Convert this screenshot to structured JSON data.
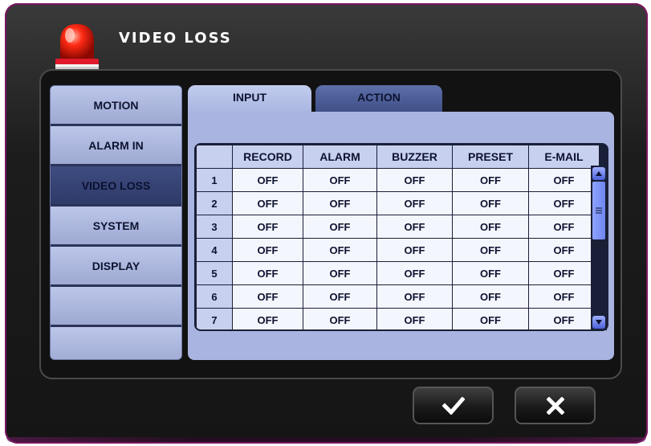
{
  "dialog": {
    "title": "VIDEO LOSS",
    "icon": "alarm-siren-icon"
  },
  "sidebar": {
    "items": [
      {
        "label": "MOTION",
        "active": false
      },
      {
        "label": "ALARM IN",
        "active": false
      },
      {
        "label": "VIDEO LOSS",
        "active": true
      },
      {
        "label": "SYSTEM",
        "active": false
      },
      {
        "label": "DISPLAY",
        "active": false
      },
      {
        "label": "",
        "active": false
      },
      {
        "label": "",
        "active": false
      }
    ]
  },
  "tabs": [
    {
      "label": "INPUT",
      "active": false
    },
    {
      "label": "ACTION",
      "active": true
    }
  ],
  "table": {
    "columns": [
      "",
      "RECORD",
      "ALARM",
      "BUZZER",
      "PRESET",
      "E-MAIL"
    ],
    "rows": [
      {
        "num": "1",
        "cells": [
          "OFF",
          "OFF",
          "OFF",
          "OFF",
          "OFF"
        ]
      },
      {
        "num": "2",
        "cells": [
          "OFF",
          "OFF",
          "OFF",
          "OFF",
          "OFF"
        ]
      },
      {
        "num": "3",
        "cells": [
          "OFF",
          "OFF",
          "OFF",
          "OFF",
          "OFF"
        ]
      },
      {
        "num": "4",
        "cells": [
          "OFF",
          "OFF",
          "OFF",
          "OFF",
          "OFF"
        ]
      },
      {
        "num": "5",
        "cells": [
          "OFF",
          "OFF",
          "OFF",
          "OFF",
          "OFF"
        ]
      },
      {
        "num": "6",
        "cells": [
          "OFF",
          "OFF",
          "OFF",
          "OFF",
          "OFF"
        ]
      },
      {
        "num": "7",
        "cells": [
          "OFF",
          "OFF",
          "OFF",
          "OFF",
          "OFF"
        ]
      }
    ]
  },
  "footer": {
    "ok_icon": "checkmark-icon",
    "cancel_icon": "close-x-icon"
  },
  "colors": {
    "accent": "#3e4e86",
    "panel": "#a9b5e0",
    "window": "#1c1c1c"
  }
}
